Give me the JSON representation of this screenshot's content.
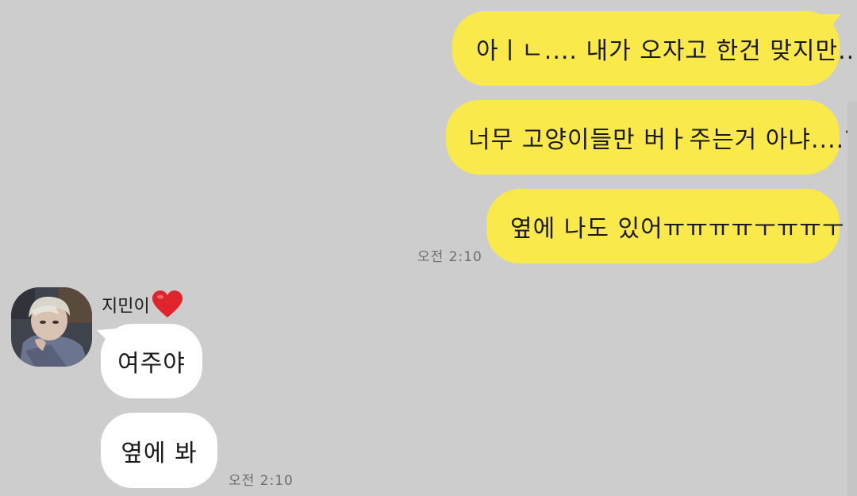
{
  "colors": {
    "background": "#cdcdcd",
    "sent_bubble": "#fae94b",
    "received_bubble": "#ffffff",
    "timestamp_text": "#6e6e6e"
  },
  "sent_messages": [
    "아ㅣㄴ.... 내가 오자고 한건 맞지만...",
    "너무 고양이들만 버ㅏ주는거 아냐....??",
    "옆에 나도 있어ㅠㅠㅠㅠㅜㅠㅠㅜ"
  ],
  "sent_time": "오전 2:10",
  "sender": {
    "name": "지민이",
    "name_emoji_icon": "red-heart-icon"
  },
  "received_messages": [
    "여주야",
    "옆에 봐"
  ],
  "received_time": "오전 2:10"
}
